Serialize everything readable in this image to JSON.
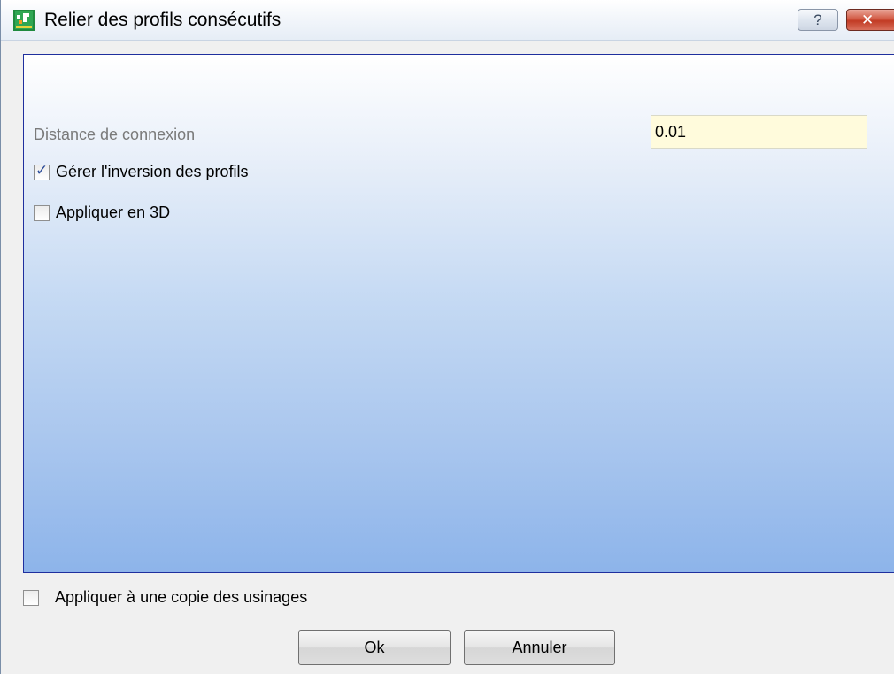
{
  "window": {
    "title": "Relier des profils consécutifs",
    "help_glyph": "?",
    "close_glyph": "✕"
  },
  "form": {
    "distance_label": "Distance de connexion",
    "distance_value": "0.01",
    "checkboxes": [
      {
        "label": "Gérer l'inversion des profils",
        "checked": true
      },
      {
        "label": "Appliquer en 3D",
        "checked": false
      }
    ]
  },
  "footer": {
    "copy_checkbox": {
      "label": "Appliquer à une copie des usinages",
      "checked": false
    },
    "ok_label": "Ok",
    "cancel_label": "Annuler"
  },
  "colors": {
    "panel_border": "#1f2f9e",
    "input_background": "#fffbdc",
    "close_button": "#c23b24"
  },
  "icons": {
    "app": "app-icon",
    "help": "help-icon",
    "close": "close-icon",
    "check": "checkmark-icon"
  }
}
